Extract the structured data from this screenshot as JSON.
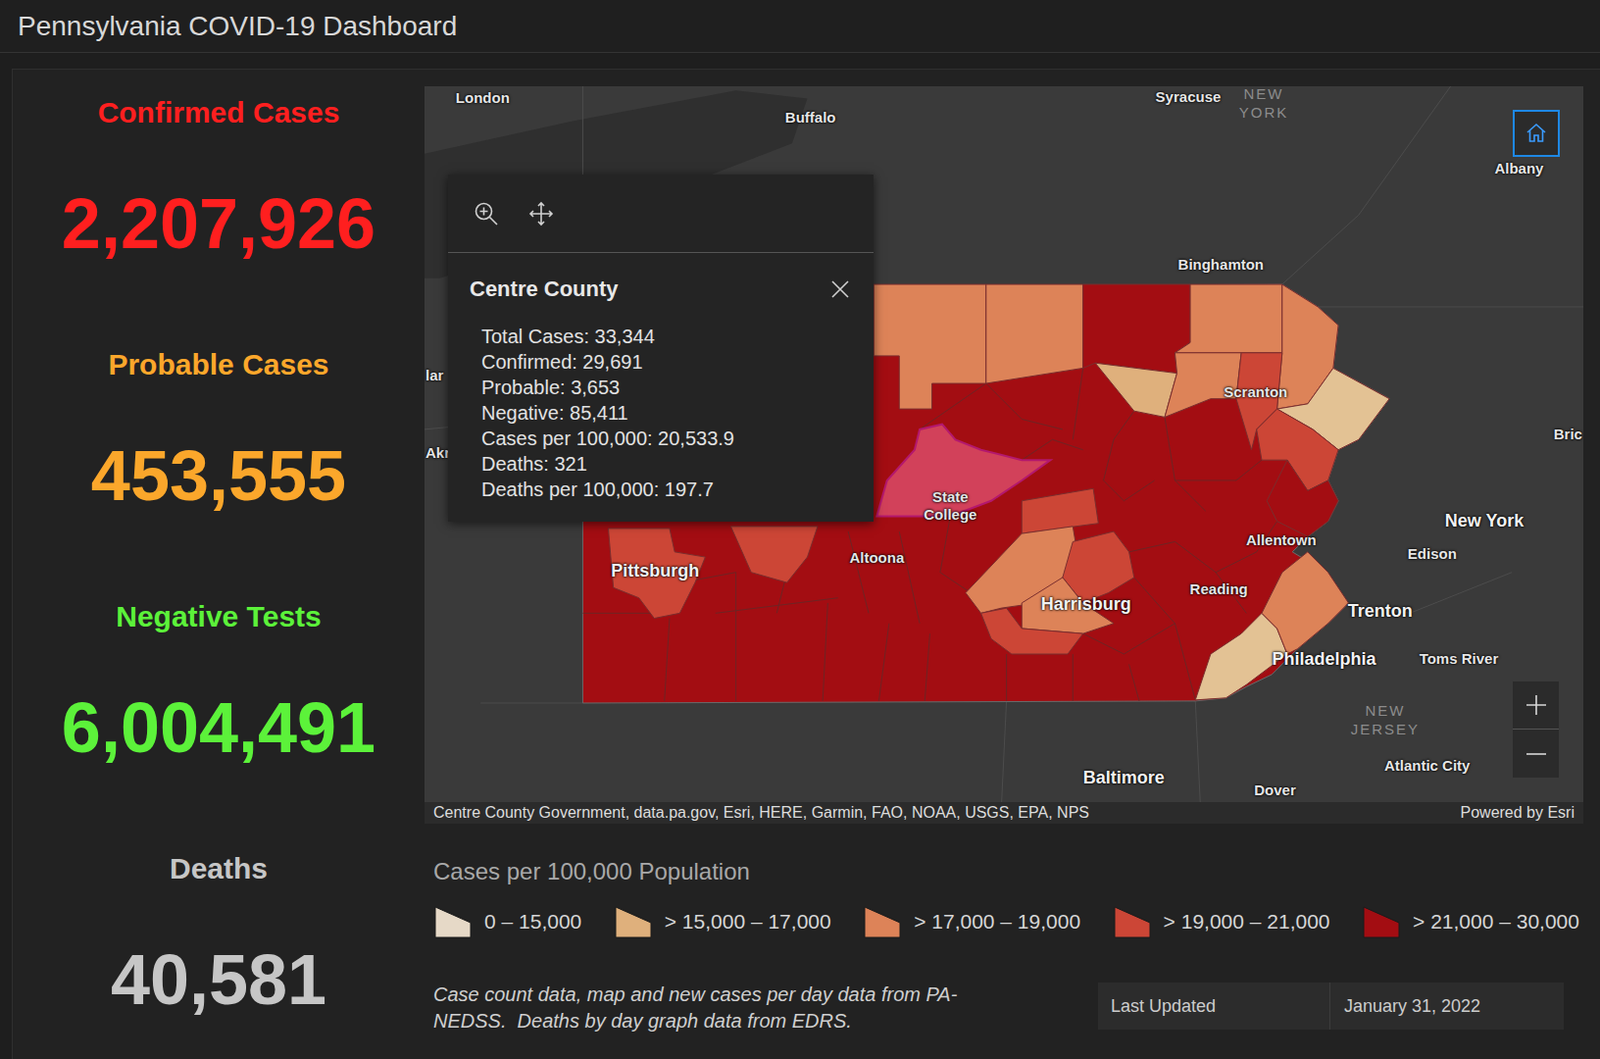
{
  "header": {
    "title": "Pennsylvania COVID-19 Dashboard"
  },
  "stats": [
    {
      "label": "Confirmed Cases",
      "value": "2,207,926",
      "color": "#ff1f1f"
    },
    {
      "label": "Probable Cases",
      "value": "453,555",
      "color": "#fba72b"
    },
    {
      "label": "Negative Tests",
      "value": "6,004,491",
      "color": "#5cf23a"
    },
    {
      "label": "Deaths",
      "value": "40,581",
      "color": "#c6c6c6"
    }
  ],
  "map": {
    "labels": [
      {
        "text": "London",
        "kind": "city"
      },
      {
        "text": "Buffalo",
        "kind": "city"
      },
      {
        "text": "Syracuse",
        "kind": "city"
      },
      {
        "text": "NEW YORK",
        "kind": "state"
      },
      {
        "text": "Albany",
        "kind": "city"
      },
      {
        "text": "Binghamton",
        "kind": "city"
      },
      {
        "text": "lar",
        "kind": "city"
      },
      {
        "text": "Akr",
        "kind": "city"
      },
      {
        "text": "Scranton",
        "kind": "city"
      },
      {
        "text": "Bric",
        "kind": "city"
      },
      {
        "text": "New York",
        "kind": "major"
      },
      {
        "text": "State College",
        "kind": "city"
      },
      {
        "text": "Allentown",
        "kind": "city"
      },
      {
        "text": "Edison",
        "kind": "city"
      },
      {
        "text": "Altoona",
        "kind": "city"
      },
      {
        "text": "Pittsburgh",
        "kind": "major"
      },
      {
        "text": "Reading",
        "kind": "city"
      },
      {
        "text": "Harrisburg",
        "kind": "major"
      },
      {
        "text": "Trenton",
        "kind": "major"
      },
      {
        "text": "Philadelphia",
        "kind": "major"
      },
      {
        "text": "Toms River",
        "kind": "city"
      },
      {
        "text": "NEW JERSEY",
        "kind": "state"
      },
      {
        "text": "Atlantic City",
        "kind": "city"
      },
      {
        "text": "Baltimore",
        "kind": "major"
      },
      {
        "text": "Dover",
        "kind": "city"
      }
    ],
    "regions": [
      {
        "color": "#a30d12",
        "selected": false
      },
      {
        "color": "#dd8358",
        "selected": false
      },
      {
        "color": "#dd8358",
        "selected": false
      },
      {
        "color": "#a30d12",
        "selected": false
      },
      {
        "color": "#dd8358",
        "selected": false
      },
      {
        "color": "#dd8358",
        "selected": false
      },
      {
        "color": "#dfb07c",
        "selected": false
      },
      {
        "color": "#dd8358",
        "selected": false
      },
      {
        "color": "#cc4636",
        "selected": false
      },
      {
        "color": "#e3c294",
        "selected": false
      },
      {
        "color": "#cc4636",
        "selected": false
      },
      {
        "color": "#a30d12",
        "selected": false
      },
      {
        "color": "#d2415a",
        "selected": true
      },
      {
        "color": "#cc4636",
        "selected": false
      },
      {
        "color": "#dd8358",
        "selected": false
      },
      {
        "color": "#cc4636",
        "selected": false
      },
      {
        "color": "#dd8358",
        "selected": false
      },
      {
        "color": "#cc4636",
        "selected": false
      },
      {
        "color": "#cc4636",
        "selected": false
      },
      {
        "color": "#cc4636",
        "selected": false
      },
      {
        "color": "#e3c294",
        "selected": false
      },
      {
        "color": "#dd8358",
        "selected": false
      }
    ],
    "attribution": "Centre County Government, data.pa.gov, Esri, HERE, Garmin, FAO, NOAA, USGS, EPA, NPS",
    "powered_by": "Powered by Esri"
  },
  "popup": {
    "title": "Centre County",
    "lines": [
      "Total Cases: 33,344",
      "Confirmed: 29,691",
      "Probable: 3,653",
      "Negative: 85,411",
      "Cases per 100,000: 20,533.9",
      "Deaths: 321",
      "Deaths per 100,000: 197.7"
    ]
  },
  "legend": {
    "title": "Cases per 100,000 Population",
    "items": [
      {
        "label": "0 – 15,000",
        "color": "#e6d9c7"
      },
      {
        "label": "> 15,000 – 17,000",
        "color": "#dfb07c"
      },
      {
        "label": "> 17,000 – 19,000",
        "color": "#dd8358"
      },
      {
        "label": "> 19,000 – 21,000",
        "color": "#cc4636"
      },
      {
        "label": "> 21,000 – 30,000",
        "color": "#a30d12"
      }
    ]
  },
  "footnote": "Case count data, map and new cases per day data from PA-NEDSS.  Deaths by day graph data from EDRS.",
  "last_updated": {
    "label": "Last Updated",
    "value": "January 31, 2022"
  }
}
